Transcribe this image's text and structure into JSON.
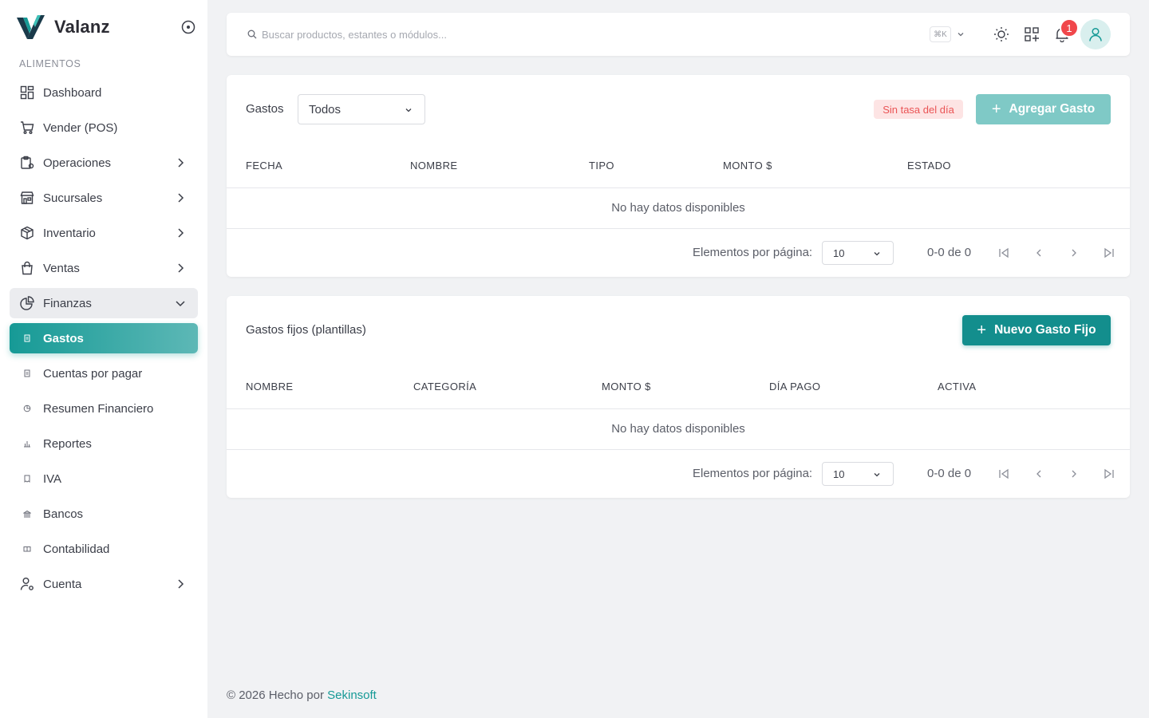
{
  "brand": {
    "name": "Valanz"
  },
  "sidebar": {
    "section": "ALIMENTOS",
    "items": [
      {
        "label": "Dashboard"
      },
      {
        "label": "Vender (POS)"
      },
      {
        "label": "Operaciones"
      },
      {
        "label": "Sucursales"
      },
      {
        "label": "Inventario"
      },
      {
        "label": "Ventas"
      },
      {
        "label": "Finanzas"
      },
      {
        "label": "Cuenta"
      }
    ],
    "finanzas_sub": [
      {
        "label": "Gastos"
      },
      {
        "label": "Cuentas por pagar"
      },
      {
        "label": "Resumen Financiero"
      },
      {
        "label": "Reportes"
      },
      {
        "label": "IVA"
      },
      {
        "label": "Bancos"
      },
      {
        "label": "Contabilidad"
      }
    ]
  },
  "topbar": {
    "search_placeholder": "Buscar productos, estantes o módulos...",
    "shortcut": "⌘K",
    "notification_count": "1"
  },
  "gastos": {
    "title": "Gastos",
    "filter_value": "Todos",
    "warning": "Sin tasa del día",
    "add_label": "Agregar Gasto",
    "columns": [
      "FECHA",
      "NOMBRE",
      "TIPO",
      "MONTO $",
      "ESTADO"
    ],
    "empty": "No hay datos disponibles",
    "per_page_label": "Elementos por página:",
    "per_page": "10",
    "range": "0-0 de 0"
  },
  "fijos": {
    "title": "Gastos fijos (plantillas)",
    "add_label": "Nuevo Gasto Fijo",
    "columns": [
      "NOMBRE",
      "CATEGORÍA",
      "MONTO $",
      "DÍA PAGO",
      "ACTIVA"
    ],
    "empty": "No hay datos disponibles",
    "per_page_label": "Elementos por página:",
    "per_page": "10",
    "range": "0-0 de 0"
  },
  "footer": {
    "text": "© 2026 Hecho por",
    "link": "Sekinsoft"
  },
  "colors": {
    "accent": "#138e8d",
    "accent_light": "#7fc9c6",
    "warning": "#ea5455",
    "badge": "#f0474b"
  }
}
